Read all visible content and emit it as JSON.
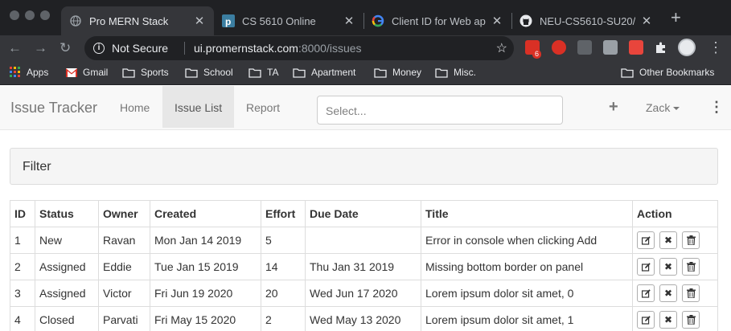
{
  "browser": {
    "tabs": [
      {
        "title": "Pro MERN Stack",
        "active": true
      },
      {
        "title": "CS 5610 Online",
        "active": false
      },
      {
        "title": "Client ID for Web app",
        "active": false
      },
      {
        "title": "NEU-CS5610-SU20/",
        "active": false
      }
    ],
    "address": {
      "security_label": "Not Secure",
      "host": "ui.promernstack.com",
      "path": ":8000/issues"
    },
    "ext_badge_count": "6",
    "bookmarks": [
      "Apps",
      "Gmail",
      "Sports",
      "School",
      "TA",
      "Apartment",
      "Money",
      "Misc."
    ],
    "other_bookmarks": "Other Bookmarks"
  },
  "app": {
    "brand": "Issue Tracker",
    "nav": [
      "Home",
      "Issue List",
      "Report"
    ],
    "active_nav": "Issue List",
    "search_placeholder": "Select...",
    "user_name": "Zack"
  },
  "filter": {
    "title": "Filter"
  },
  "table": {
    "headers": [
      "ID",
      "Status",
      "Owner",
      "Created",
      "Effort",
      "Due Date",
      "Title",
      "Action"
    ],
    "rows": [
      [
        "1",
        "New",
        "Ravan",
        "Mon Jan 14 2019",
        "5",
        "",
        "Error in console when clicking Add"
      ],
      [
        "2",
        "Assigned",
        "Eddie",
        "Tue Jan 15 2019",
        "14",
        "Thu Jan 31 2019",
        "Missing bottom border on panel"
      ],
      [
        "3",
        "Assigned",
        "Victor",
        "Fri Jun 19 2020",
        "20",
        "Wed Jun 17 2020",
        "Lorem ipsum dolor sit amet, 0"
      ],
      [
        "4",
        "Closed",
        "Parvati",
        "Fri May 15 2020",
        "2",
        "Wed May 13 2020",
        "Lorem ipsum dolor sit amet, 1"
      ]
    ]
  },
  "colors": {
    "chrome_dark": "#202124",
    "chrome_toolbar": "#35363a",
    "navbar_bg": "#f8f8f8",
    "navbar_active": "#e7e7e7",
    "panel_bg": "#f5f5f5"
  },
  "icons": {
    "tab_favicons": [
      "globe-icon",
      "p-logo-icon",
      "google-icon",
      "github-icon"
    ],
    "actions": [
      "edit-icon",
      "close-icon",
      "trash-icon"
    ]
  }
}
